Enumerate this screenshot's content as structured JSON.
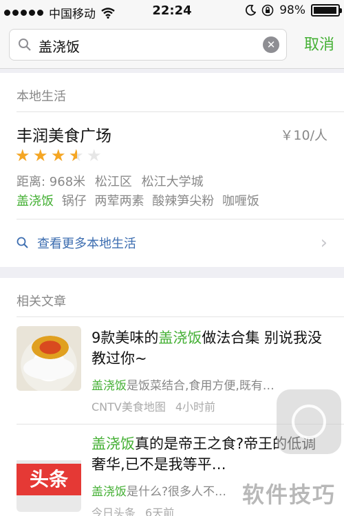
{
  "status_bar": {
    "carrier": "中国移动",
    "time": "22:24",
    "battery": "98%",
    "battery_level": 0.98
  },
  "search": {
    "query": "盖浇饭",
    "cancel_label": "取消"
  },
  "local_life": {
    "section_title": "本地生活",
    "place": {
      "name": "丰润美食广场",
      "price": "￥10/人",
      "rating": 3.5,
      "rating_max": 5,
      "distance": "距离: 968米",
      "district": "松江区",
      "area": "松江大学城",
      "tags": [
        "盖浇饭",
        "锅仔",
        "两荤两素",
        "酸辣笋尖粉",
        "咖喱饭"
      ]
    },
    "more_label": "查看更多本地生活"
  },
  "articles": {
    "section_title": "相关文章",
    "items": [
      {
        "title_hl_prefix": "9款美味的",
        "title_hl": "盖浇饭",
        "title_rest": "做法合集 别说我没教过你~",
        "snippet_hl": "盖浇饭",
        "snippet_rest": "是饭菜结合,食用方便,既有…",
        "source": "CNTV美食地图",
        "time": "4小时前",
        "thumb": "food-icon"
      },
      {
        "title_hl_prefix": "",
        "title_hl": "盖浇饭",
        "title_rest": "真的是帝王之食?帝王的低调奢华,已不是我等平…",
        "snippet_hl": "盖浇饭",
        "snippet_rest": "是什么?很多人不…",
        "source": "今日头条",
        "time": "6天前",
        "thumb_label": "头条"
      }
    ]
  },
  "watermark": "软件技巧"
}
